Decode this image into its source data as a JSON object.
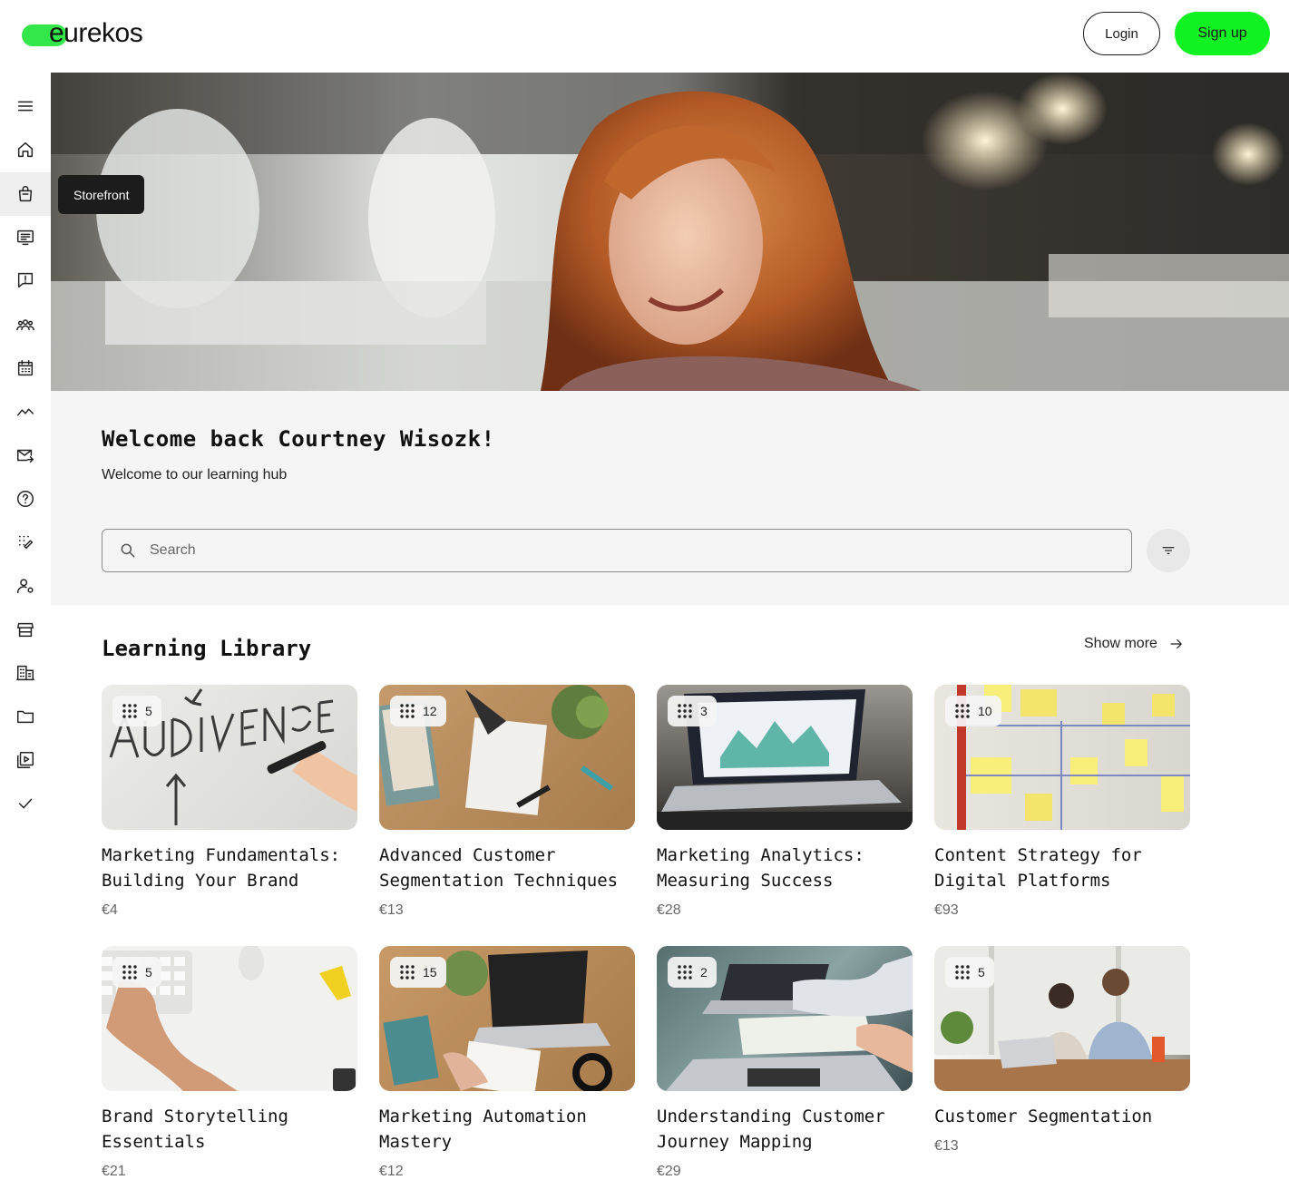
{
  "header": {
    "logo_text": "eurekos",
    "login_label": "Login",
    "signup_label": "Sign up"
  },
  "sidebar": {
    "items": [
      {
        "icon": "menu-icon"
      },
      {
        "icon": "home-icon"
      },
      {
        "icon": "shopping-bag-icon"
      },
      {
        "icon": "courses-icon"
      },
      {
        "icon": "feedback-icon"
      },
      {
        "icon": "community-icon"
      },
      {
        "icon": "calendar-icon"
      },
      {
        "icon": "analytics-icon"
      },
      {
        "icon": "mail-send-icon"
      },
      {
        "icon": "help-icon"
      },
      {
        "icon": "ai-magic-icon"
      },
      {
        "icon": "user-settings-icon"
      },
      {
        "icon": "storefront-icon"
      },
      {
        "icon": "building-icon"
      },
      {
        "icon": "folder-icon"
      },
      {
        "icon": "video-library-icon"
      },
      {
        "icon": "checkmark-icon"
      }
    ],
    "tooltip": "Storefront"
  },
  "welcome": {
    "title": "Welcome back Courtney Wisozk!",
    "subtitle": "Welcome to our learning hub"
  },
  "search": {
    "placeholder": "Search"
  },
  "library": {
    "title": "Learning Library",
    "show_more": "Show more",
    "courses": [
      {
        "count": "5",
        "title": "Marketing Fundamentals: Building Your Brand",
        "price": "€4"
      },
      {
        "count": "12",
        "title": "Advanced Customer Segmentation Techniques",
        "price": "€13"
      },
      {
        "count": "3",
        "title": "Marketing Analytics: Measuring Success",
        "price": "€28"
      },
      {
        "count": "10",
        "title": "Content Strategy for Digital Platforms",
        "price": "€93"
      },
      {
        "count": "5",
        "title": "Brand Storytelling Essentials",
        "price": "€21"
      },
      {
        "count": "15",
        "title": "Marketing Automation Mastery",
        "price": "€12"
      },
      {
        "count": "2",
        "title": "Understanding Customer Journey Mapping",
        "price": "€29"
      },
      {
        "count": "5",
        "title": "Customer Segmentation",
        "price": "€13"
      }
    ]
  },
  "colors": {
    "accent": "#11f223",
    "panel": "#f5f5f5"
  }
}
